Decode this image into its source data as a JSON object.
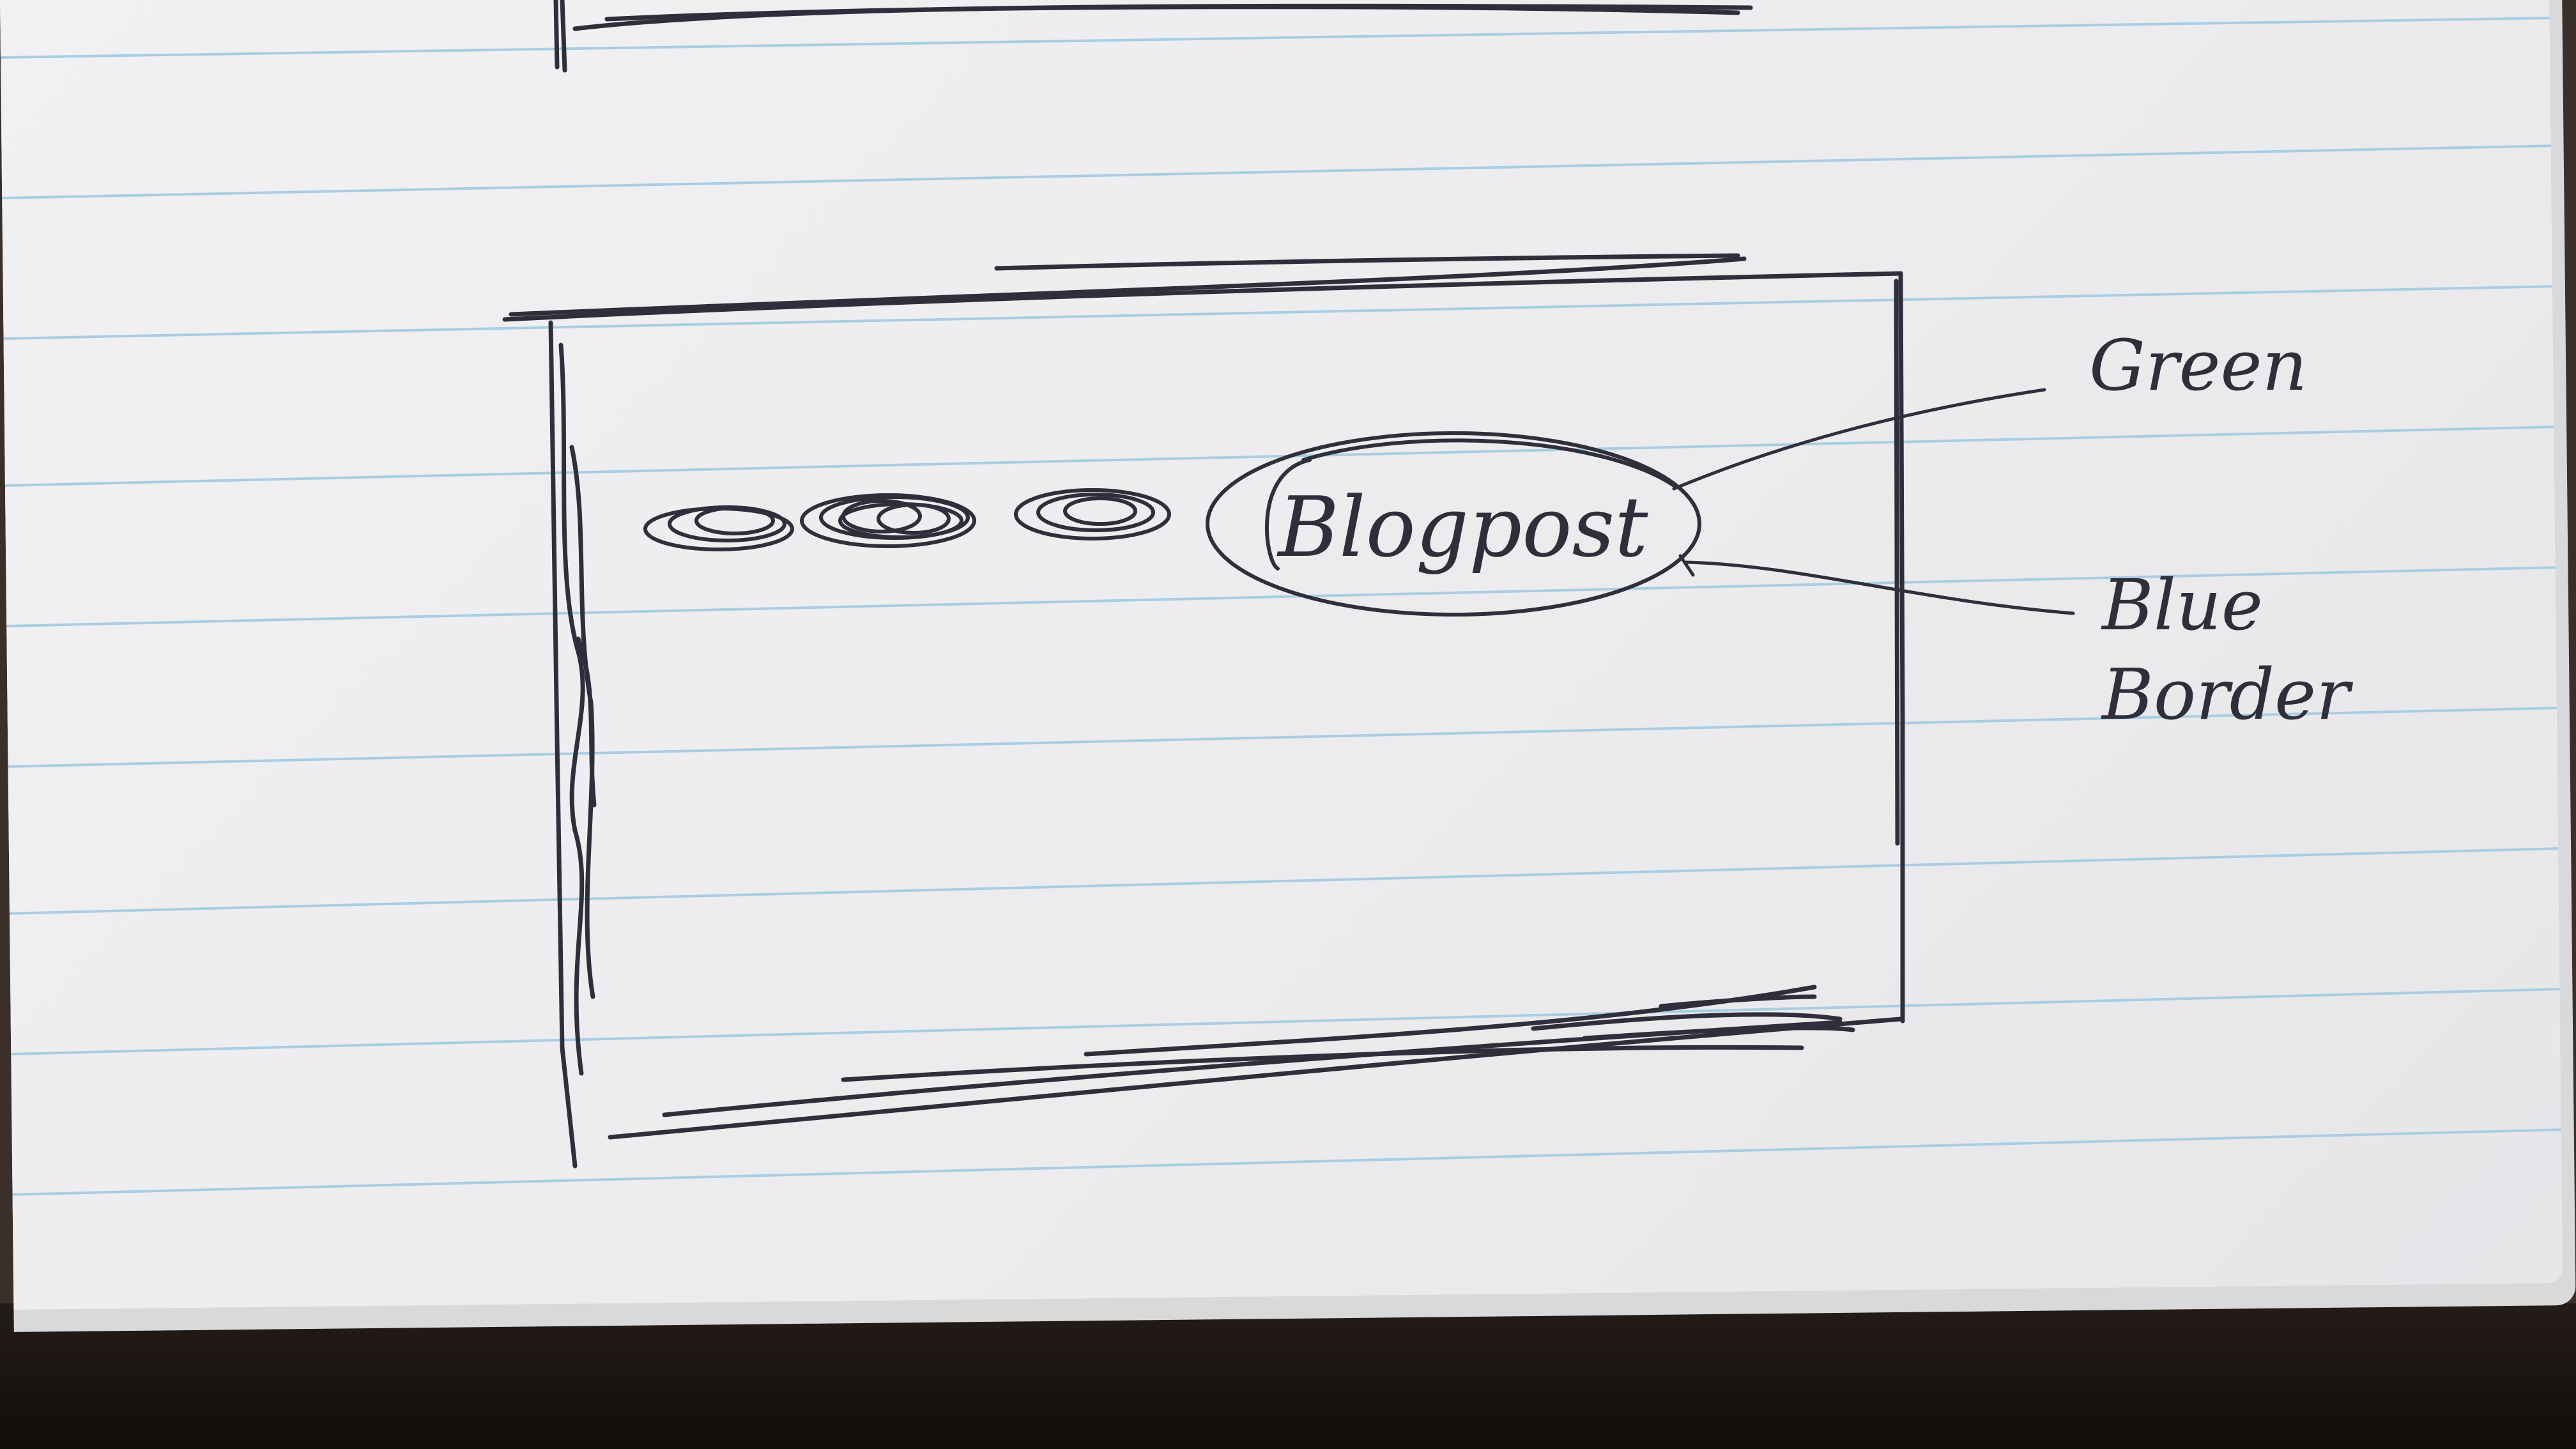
{
  "sketch": {
    "nav_button_text": "Blogpost",
    "annotations": [
      {
        "id": "green",
        "text": "Green"
      },
      {
        "id": "blue-border",
        "lines": [
          "Blue",
          "Border"
        ]
      }
    ],
    "nav_placeholders": 3,
    "colors": {
      "ink": "#2f2f3c",
      "paper": "#ececee",
      "rule": "#a9cde2"
    }
  }
}
